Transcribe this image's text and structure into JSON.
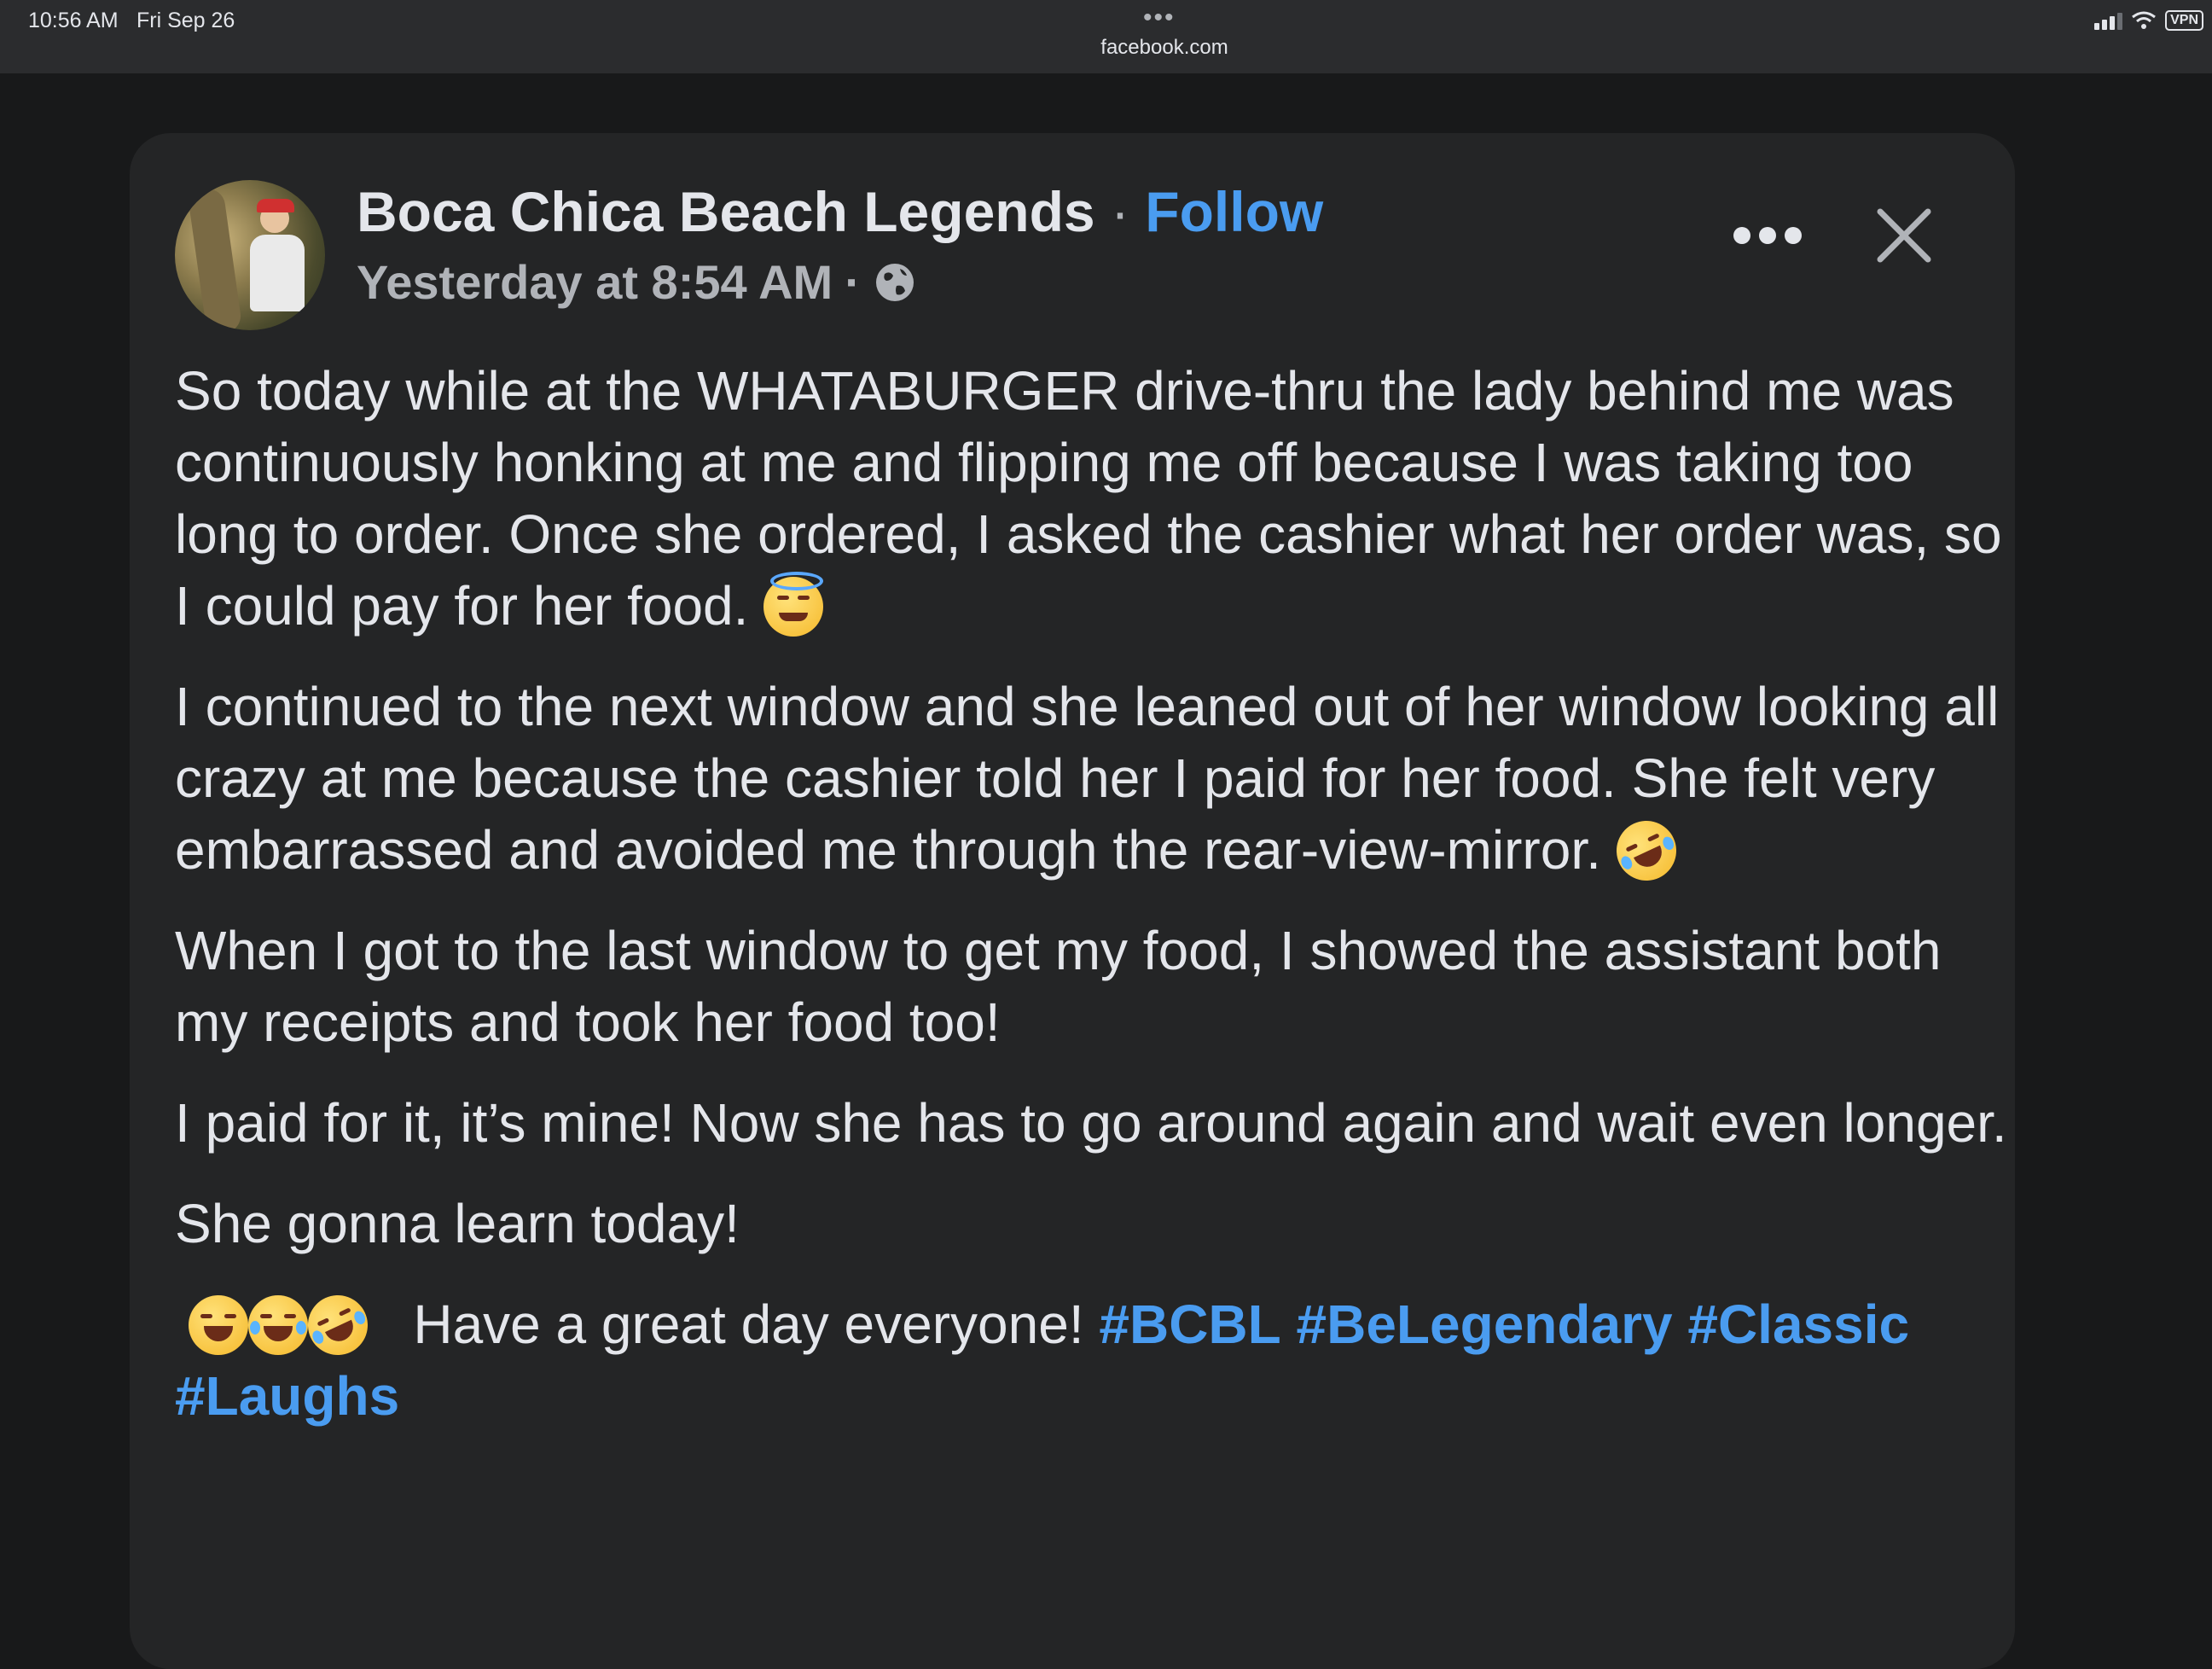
{
  "status_bar": {
    "time": "10:56 AM",
    "date": "Fri Sep 26",
    "url": "facebook.com",
    "vpn_label": "VPN"
  },
  "post": {
    "page_name": "Boca Chica Beach Legends",
    "separator": "·",
    "follow_label": "Follow",
    "timestamp": "Yesterday at 8:54 AM",
    "meta_separator": "·",
    "privacy_icon": "globe-icon",
    "paragraphs": {
      "p1": "So today while at the WHATABURGER drive-thru the lady behind me was continuously honking at me and flipping me off because I was taking too long to order. Once she ordered, I asked the cashier what her order was, so I could pay for her food.",
      "p2": "I continued to the next window and she leaned out of her window looking all crazy at me because the cashier told her I paid for her food. She felt very embarrassed and avoided me through the rear-view-mirror.",
      "p3": "When I got to the last window to get my food, I showed the assistant both my receipts and took her food too!",
      "p4": "I paid for it, it’s mine! Now she has to go around again and wait even longer.",
      "p5": "She gonna learn today!",
      "p6": "Have a great day everyone!"
    },
    "hashtags": [
      "#BCBL",
      "#BeLegendary",
      "#Classic",
      "#Laughs"
    ]
  },
  "colors": {
    "background": "#18191a",
    "card": "#242526",
    "text": "#e4e6eb",
    "secondary_text": "#b0b3b8",
    "link": "#4a9cf0"
  }
}
